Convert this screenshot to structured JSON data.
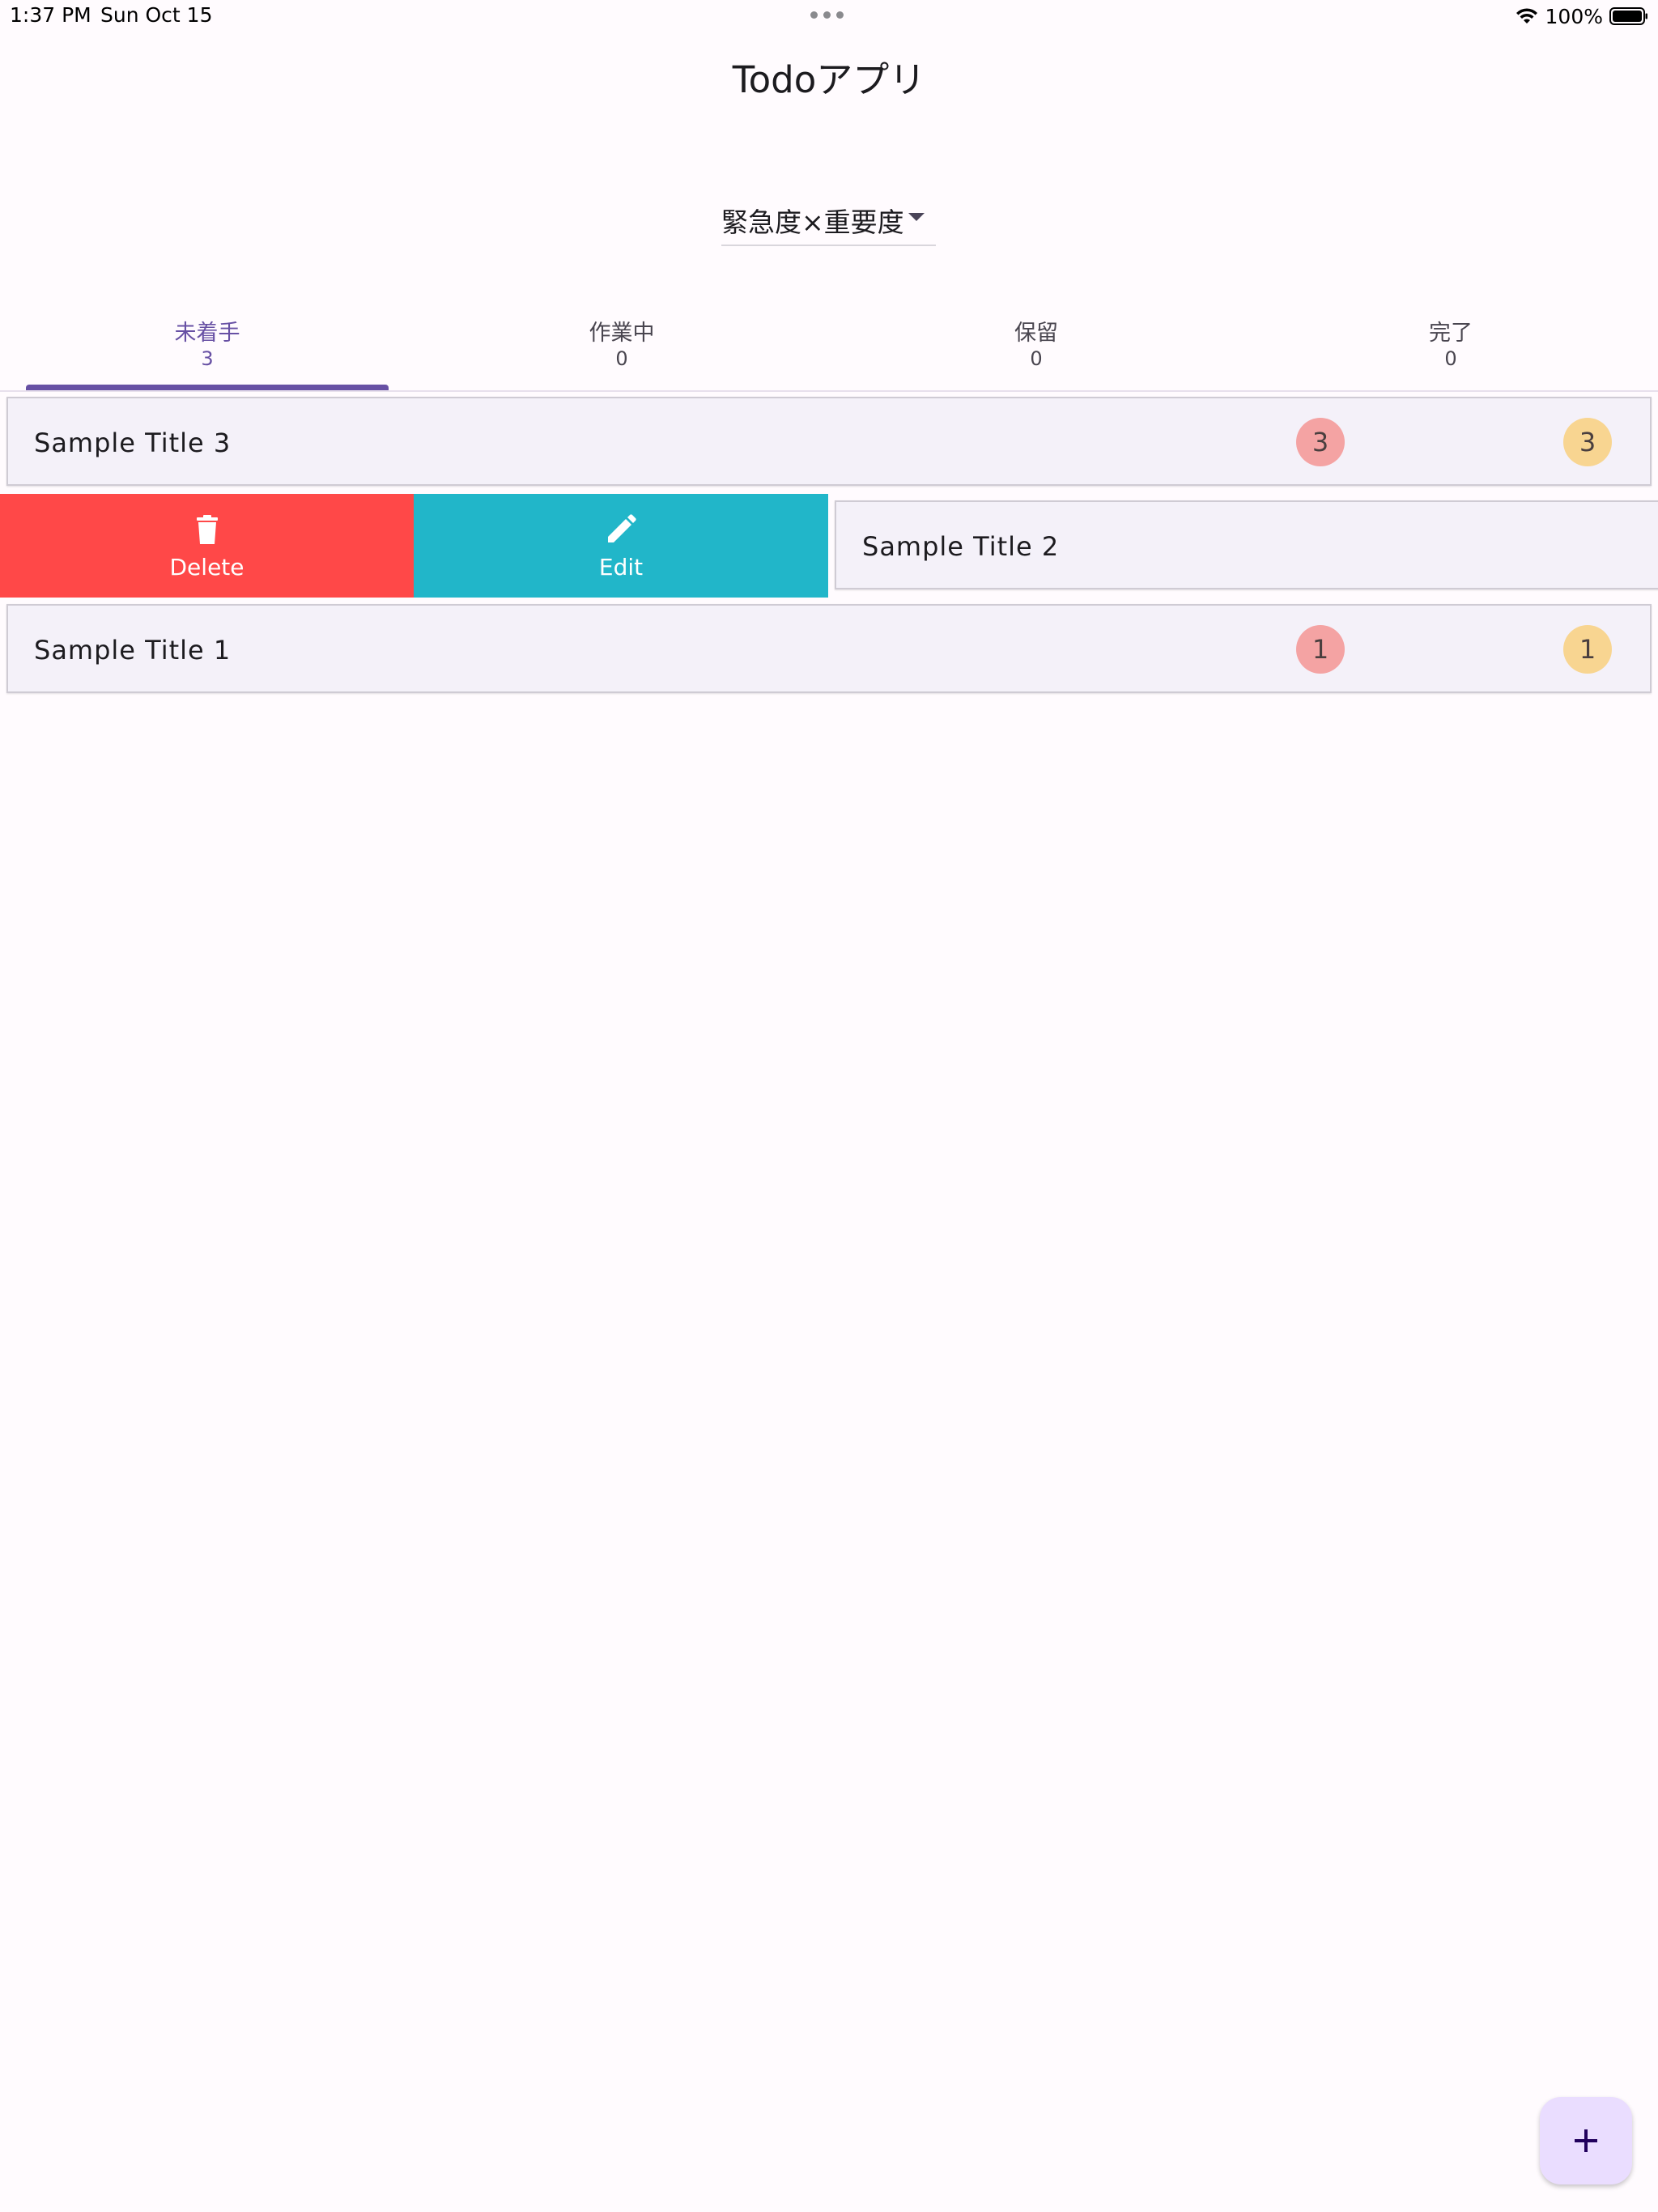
{
  "status_bar": {
    "time": "1:37 PM",
    "date": "Sun Oct 15",
    "battery": "100%"
  },
  "app_bar": {
    "title": "Todoアプリ"
  },
  "sort": {
    "selected": "緊急度×重要度"
  },
  "tabs": [
    {
      "label": "未着手",
      "count": "3",
      "active": true
    },
    {
      "label": "作業中",
      "count": "0",
      "active": false
    },
    {
      "label": "保留",
      "count": "0",
      "active": false
    },
    {
      "label": "完了",
      "count": "0",
      "active": false
    }
  ],
  "todos": [
    {
      "title": "Sample Title 3",
      "urgency": "3",
      "importance": "3"
    },
    {
      "title": "Sample Title 2"
    },
    {
      "title": "Sample Title 1",
      "urgency": "1",
      "importance": "1"
    }
  ],
  "actions": {
    "delete_label": "Delete",
    "edit_label": "Edit"
  },
  "colors": {
    "accent": "#6750a4",
    "delete": "#ff4848",
    "edit": "#21b6c9",
    "urgency_badge": "#f4a3a3",
    "importance_badge": "#f8d591",
    "fab": "#eaddff"
  },
  "icons": {
    "delete": "trash-icon",
    "edit": "pencil-icon",
    "fab": "plus-icon",
    "sort": "caret-down-icon"
  }
}
